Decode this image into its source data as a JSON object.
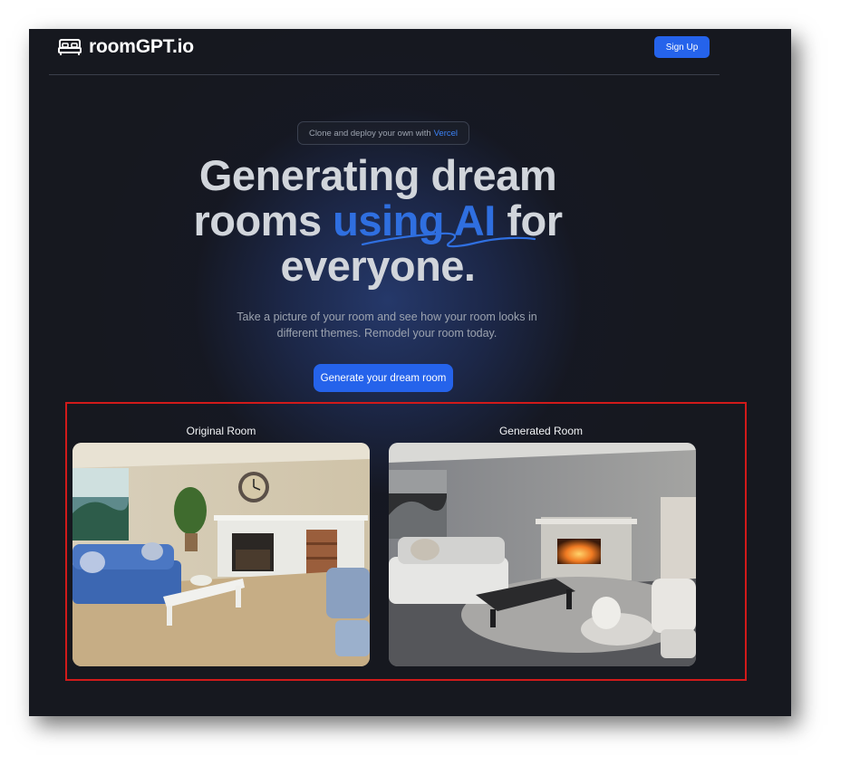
{
  "header": {
    "logo_text": "roomGPT.io",
    "logo_icon": "bed-icon",
    "signup_label": "Sign Up"
  },
  "hero": {
    "promo_text": "Clone and deploy your own with",
    "promo_link": "Vercel",
    "headline_part1": "Generating dream rooms",
    "headline_highlight": "using AI",
    "headline_part2": "for everyone.",
    "subtitle": "Take a picture of your room and see how your room looks in different themes. Remodel your room today.",
    "cta_label": "Generate your dream room"
  },
  "comparison": {
    "original_label": "Original Room",
    "generated_label": "Generated Room"
  },
  "colors": {
    "accent": "#2563eb",
    "background": "#16181f",
    "highlight_box": "#d11a1a"
  }
}
